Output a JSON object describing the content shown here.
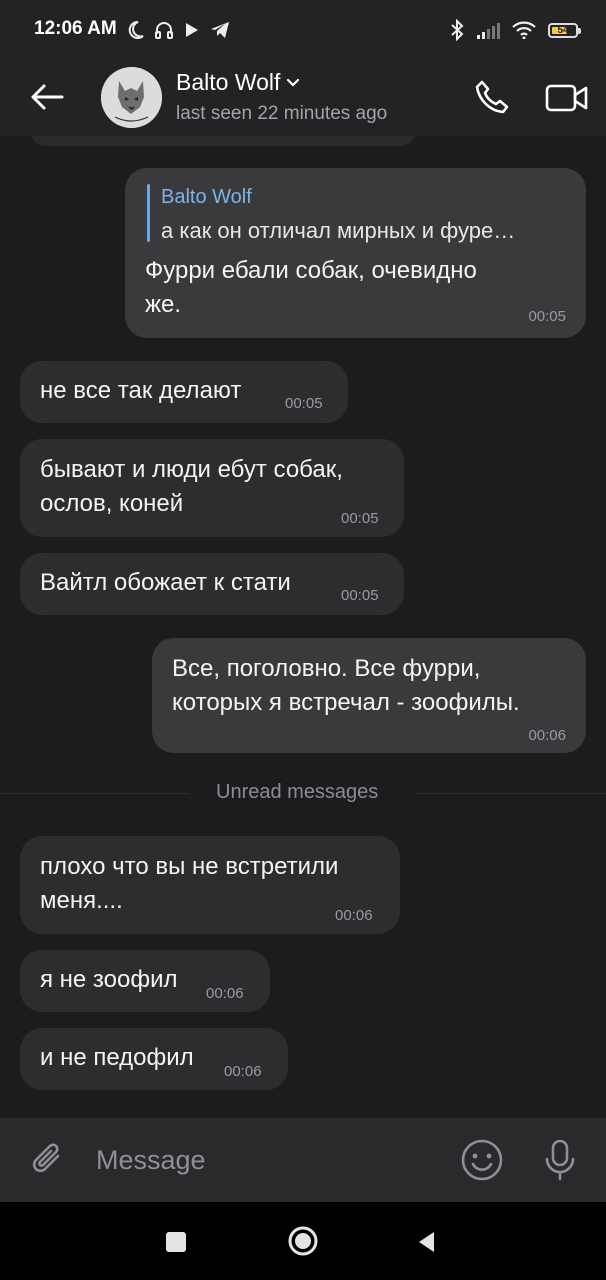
{
  "status_bar": {
    "time": "12:06 AM",
    "battery_level": "54",
    "left_icons": [
      "moon-icon",
      "headphones-icon",
      "play-icon",
      "telegram-icon"
    ],
    "right_icons": [
      "bluetooth-icon",
      "signal-icon",
      "wifi-icon",
      "battery-icon"
    ]
  },
  "header": {
    "contact_name": "Balto Wolf",
    "status": "last seen 22 minutes ago",
    "avatar_text": "Balto Wolf"
  },
  "messages": [
    {
      "direction": "out",
      "reply_to_name": "Balto Wolf",
      "reply_to_text": "а как он отличал мирных и фуре…",
      "text": "Фурри ебали собак, очевидно\nже.",
      "time": "00:05"
    },
    {
      "direction": "in",
      "text": "не все так делают",
      "time": "00:05"
    },
    {
      "direction": "in",
      "text": "бывают и люди ебут собак,\nослов, коней",
      "time": "00:05"
    },
    {
      "direction": "in",
      "text": "Вайтл обожает к стати",
      "time": "00:05"
    },
    {
      "direction": "out",
      "text": "Все, поголовно. Все фурри,\nкоторых я встречал - зоофилы.",
      "time": "00:06"
    },
    {
      "direction": "in",
      "text": "плохо что вы не встретили\nменя....",
      "time": "00:06"
    },
    {
      "direction": "in",
      "text": "я не зоофил",
      "time": "00:06"
    },
    {
      "direction": "in",
      "text": "и не педофил",
      "time": "00:06"
    }
  ],
  "unread_label": "Unread messages",
  "input": {
    "placeholder": "Message"
  },
  "colors": {
    "background": "#1c1c1e",
    "header": "#232325",
    "incoming_bubble": "#2d2d30",
    "outgoing_bubble": "#3a3a3d",
    "reply_accent": "#6aa9e3"
  }
}
